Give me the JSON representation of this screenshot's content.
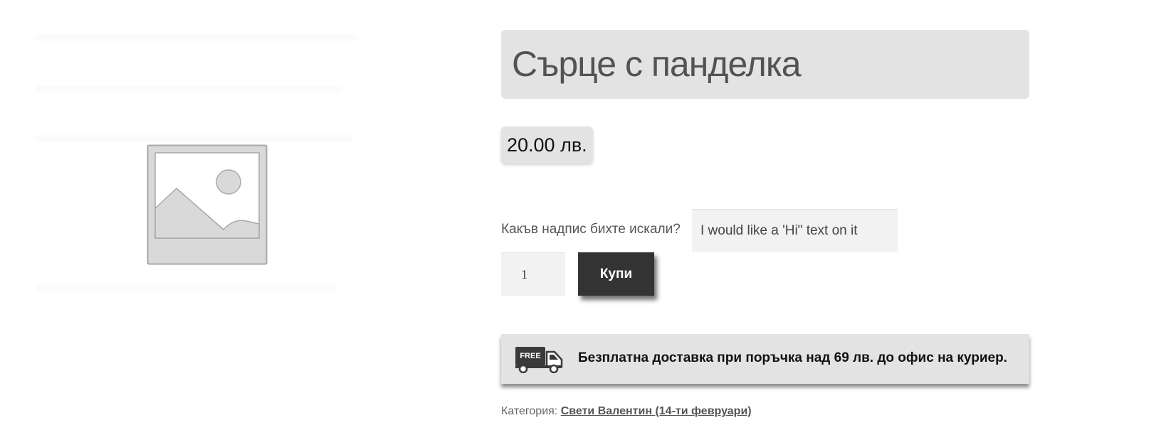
{
  "product": {
    "title": "Сърце с панделка",
    "price": "20.00 лв.",
    "image_icon": "image-placeholder-icon"
  },
  "addon": {
    "label": "Какъв надпис бихте искали?",
    "value": "I would like a 'Hi\" text on it"
  },
  "cart": {
    "quantity": "1",
    "buy_label": "Купи"
  },
  "shipping": {
    "icon": "free-delivery-truck-icon",
    "badge": "FREE",
    "text": "Безплатна доставка при поръчка над 69 лв. до офис на куриер."
  },
  "meta": {
    "category_label": "Категория:",
    "category_link": "Свети Валентин (14-ти февруари)"
  },
  "colors": {
    "panel": "#e3e3e3",
    "button": "#333333",
    "input": "#f2f2f2"
  }
}
